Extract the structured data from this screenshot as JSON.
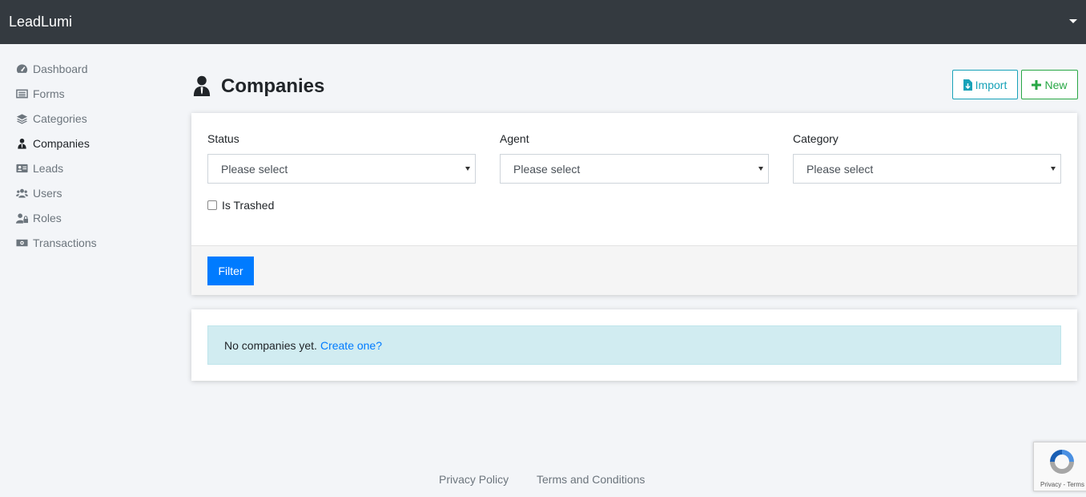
{
  "navbar": {
    "brand": "LeadLumi"
  },
  "sidebar": {
    "items": [
      {
        "label": "Dashboard",
        "icon": "dashboard-icon"
      },
      {
        "label": "Forms",
        "icon": "forms-icon"
      },
      {
        "label": "Categories",
        "icon": "layers-icon"
      },
      {
        "label": "Companies",
        "icon": "user-tie-icon",
        "active": true
      },
      {
        "label": "Leads",
        "icon": "id-card-icon"
      },
      {
        "label": "Users",
        "icon": "users-icon"
      },
      {
        "label": "Roles",
        "icon": "user-lock-icon"
      },
      {
        "label": "Transactions",
        "icon": "money-icon"
      }
    ]
  },
  "header": {
    "title": "Companies",
    "import_label": "Import",
    "new_label": "New"
  },
  "filters": {
    "status": {
      "label": "Status",
      "value": "Please select"
    },
    "agent": {
      "label": "Agent",
      "value": "Please select"
    },
    "category": {
      "label": "Category",
      "value": "Please select"
    },
    "is_trashed_label": "Is Trashed",
    "is_trashed_checked": false,
    "filter_button": "Filter"
  },
  "list": {
    "empty_text": "No companies yet.",
    "create_link": "Create one?"
  },
  "footer": {
    "privacy": "Privacy Policy",
    "terms": "Terms and Conditions"
  },
  "recaptcha": {
    "text": "Privacy - Terms"
  },
  "colors": {
    "navbar": "#343a40",
    "primary": "#007bff",
    "info": "#17a2b8",
    "success": "#28a745",
    "alert_bg": "#d1ecf1"
  }
}
